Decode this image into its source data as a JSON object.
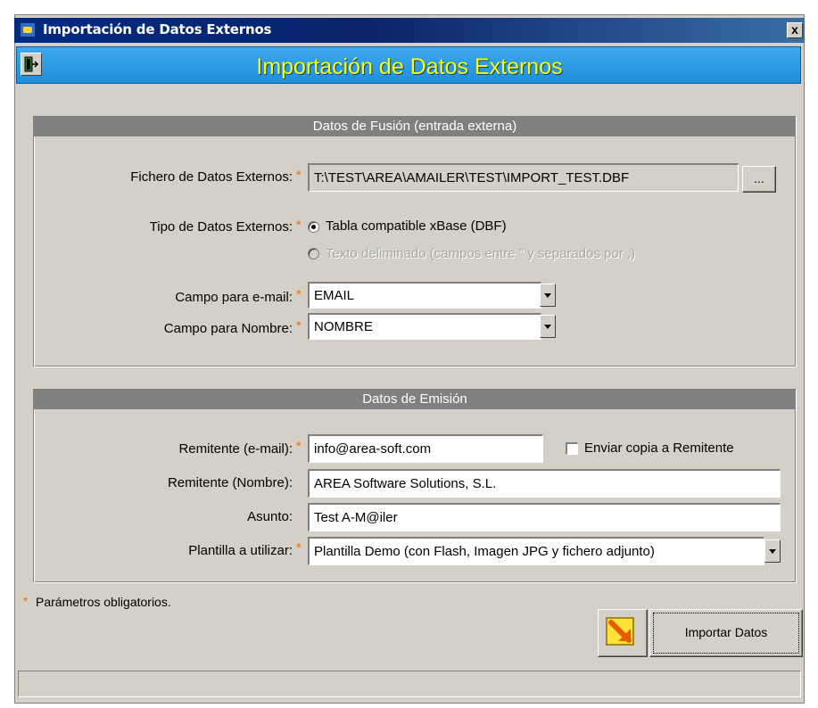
{
  "window": {
    "title": "Importación de Datos Externos",
    "close_label": "x"
  },
  "header": {
    "title": "Importación de Datos Externos"
  },
  "fusion": {
    "heading": "Datos de Fusión (entrada externa)",
    "file_label": "Fichero de Datos Externos:",
    "file_value": "T:\\TEST\\AREA\\AMAILER\\TEST\\IMPORT_TEST.DBF",
    "browse_label": "...",
    "type_label": "Tipo de Datos Externos:",
    "type_options": [
      {
        "label": "Tabla compatible xBase (DBF)",
        "checked": true,
        "enabled": true
      },
      {
        "label": "Texto deliminado (campos entre \" y separados por ,)",
        "checked": false,
        "enabled": false
      }
    ],
    "email_field_label": "Campo para e-mail:",
    "email_field_value": "EMAIL",
    "name_field_label": "Campo para Nombre:",
    "name_field_value": "NOMBRE"
  },
  "emision": {
    "heading": "Datos de Emisión",
    "sender_email_label": "Remitente (e-mail):",
    "sender_email_value": "info@area-soft.com",
    "send_copy_label": "Enviar copia a Remitente",
    "send_copy_checked": false,
    "sender_name_label": "Remitente (Nombre):",
    "sender_name_value": "AREA Software Solutions, S.L.",
    "subject_label": "Asunto:",
    "subject_value": "Test A-M@iler",
    "template_label": "Plantilla a utilizar:",
    "template_value": "Plantilla Demo (con Flash, Imagen JPG y fichero adjunto)"
  },
  "footer": {
    "required_mark": "*",
    "required_note": "Parámetros obligatorios.",
    "import_button_label": "Importar Datos"
  },
  "colors": {
    "title_bar": "#0a246a",
    "header_bar": "#2f9be6",
    "header_text": "#ffff00",
    "required_mark": "#ff6a00",
    "group_heading": "#808080",
    "window_bg": "#d4d0c8"
  }
}
